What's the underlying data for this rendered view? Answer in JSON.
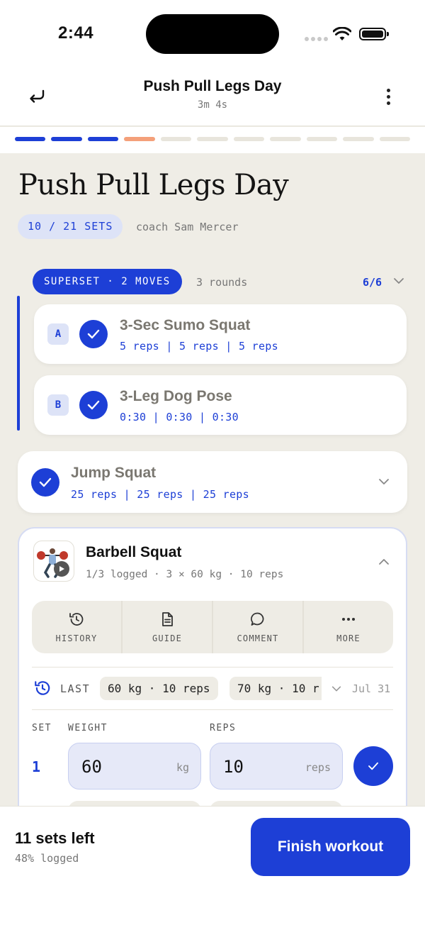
{
  "status_bar": {
    "time": "2:44"
  },
  "nav": {
    "title": "Push Pull Legs Day",
    "elapsed": "3m 4s"
  },
  "progress": {
    "total_segments": 11,
    "completed": 3,
    "current": 1,
    "colors": {
      "completed": "#1d3fd6",
      "current": "#f4a07a",
      "pending": "#e8e5dc"
    }
  },
  "workout": {
    "title": "Push Pull Legs Day",
    "sets_badge": "10 / 21 SETS",
    "coach": "coach Sam Mercer"
  },
  "superset": {
    "label": "SUPERSET · 2 MOVES",
    "rounds": "3 rounds",
    "count": "6/6",
    "items": [
      {
        "letter": "A",
        "name": "3-Sec Sumo Squat",
        "reps": "5 reps | 5 reps | 5 reps"
      },
      {
        "letter": "B",
        "name": "3-Leg Dog Pose",
        "reps": "0:30 | 0:30 | 0:30"
      }
    ]
  },
  "jump_squat": {
    "name": "Jump Squat",
    "reps": "25 reps | 25 reps | 25 reps"
  },
  "barbell_squat": {
    "name": "Barbell Squat",
    "meta": "1/3 logged · 3 × 60 kg · 10 reps",
    "tools": [
      {
        "label": "HISTORY",
        "icon": "history-icon"
      },
      {
        "label": "GUIDE",
        "icon": "document-icon"
      },
      {
        "label": "COMMENT",
        "icon": "comment-icon"
      },
      {
        "label": "MORE",
        "icon": "more-icon"
      }
    ],
    "last": {
      "label": "LAST",
      "chips": [
        "60 kg · 10 reps",
        "70 kg · 10 r"
      ],
      "date": "Jul 31"
    },
    "columns": {
      "set": "SET",
      "weight": "WEIGHT",
      "reps": "REPS"
    },
    "sets": [
      {
        "number": "1",
        "weight": "60",
        "weight_unit": "kg",
        "reps": "10",
        "reps_unit": "reps"
      }
    ]
  },
  "footer": {
    "sets_left": "11 sets left",
    "logged": "48% logged",
    "finish_label": "Finish workout"
  },
  "colors": {
    "accent": "#1d3fd6",
    "background": "#efede6",
    "accent_soft": "#dde3f7"
  }
}
